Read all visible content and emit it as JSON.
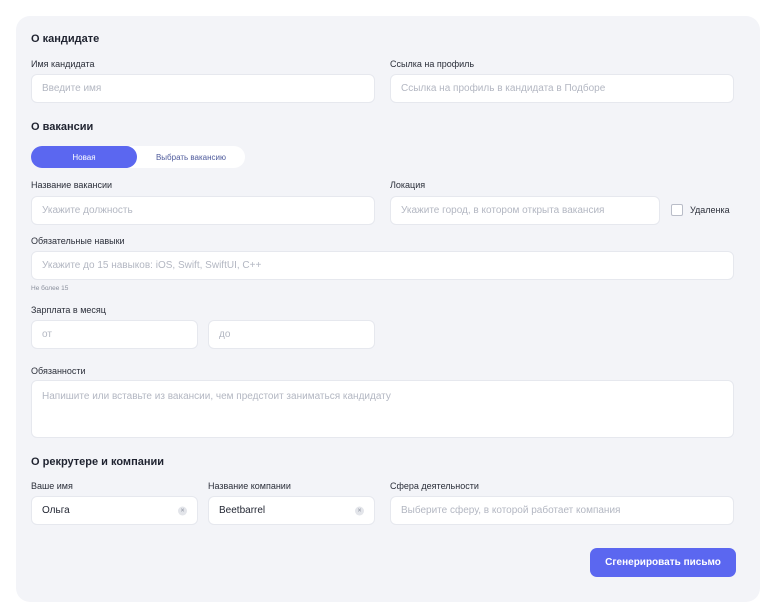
{
  "candidate": {
    "title": "О кандидате",
    "name_label": "Имя кандидата",
    "name_placeholder": "Введите имя",
    "profile_label": "Ссылка на профиль",
    "profile_placeholder": "Ссылка на профиль в кандидата в Подборе"
  },
  "vacancy": {
    "title": "О вакансии",
    "toggle": {
      "new": "Новая",
      "choose": "Выбрать вакансию",
      "selected": "Новая"
    },
    "name_label": "Название вакансии",
    "name_placeholder": "Укажите должность",
    "location_label": "Локация",
    "location_placeholder": "Укажите город, в котором открыта вакансия",
    "remote_label": "Удаленка",
    "remote_checked": false,
    "skills_label": "Обязательные навыки",
    "skills_placeholder": "Укажите до 15 навыков: iOS, Swift, SwiftUI, C++",
    "skills_hint": "Не более 15",
    "salary_label": "Зарплата в месяц",
    "salary_from_placeholder": "от",
    "salary_to_placeholder": "до",
    "duties_label": "Обязанности",
    "duties_placeholder": "Напишите или вставьте из вакансии, чем предстоит заниматься кандидату"
  },
  "recruiter": {
    "title": "О рекрутере и компании",
    "name_label": "Ваше имя",
    "name_value": "Ольга",
    "company_label": "Название компании",
    "company_value": "Beetbarrel",
    "sphere_label": "Сфера деятельности",
    "sphere_placeholder": "Выберите сферу, в которой работает компания"
  },
  "actions": {
    "submit_label": "Сгенерировать письмо"
  },
  "icons": {
    "clear": "×"
  },
  "colors": {
    "accent": "#5b67f0",
    "background": "#f3f4f8"
  }
}
